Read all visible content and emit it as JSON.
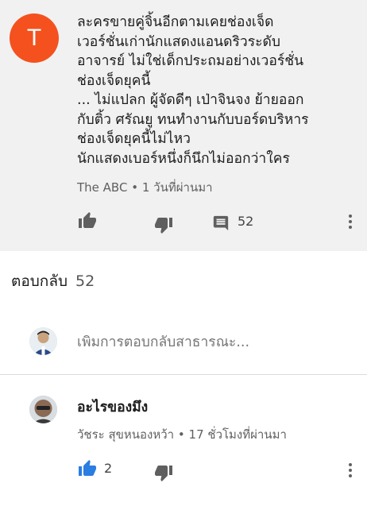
{
  "comment": {
    "avatar_letter": "T",
    "avatar_color": "#f4511e",
    "text": "ละครขายคู่จิ้นอีกตามเคยช่องเจ็ด\nเวอร์ชั่นเก่านักแสดงแอนดริวระดับ\nอาจารย์ ไม่ใช่เด็กประถมอย่างเวอร์ชั่น\nช่องเจ็ดยุคนี้\n... ไม่แปลก ผู้จัดดีๆ เป่าจินจง ย้ายออก\nกับติ้ว ศรัณยู ทนทำงานกับบอร์ดบริหาร\nช่องเจ็ดยุคนี้ไม่ไหว\nนักแสดงเบอร์หนึ่งก็นึกไม่ออกว่าใคร",
    "author": "The ABC",
    "separator": "•",
    "time": "1 วันที่ผ่านมา",
    "reply_count": "52",
    "icons": [
      "thumb-up-icon",
      "thumb-down-icon",
      "comment-icon",
      "more-vert-icon"
    ]
  },
  "replies_section": {
    "label": "ตอบกลับ",
    "count": "52",
    "input_placeholder": "เพิ่มการตอบกลับสาธารณะ..."
  },
  "reply": {
    "title": "อะไรของมึง",
    "author": "วัชระ สุขหนองหว้า",
    "separator": "•",
    "time": "17 ชั่วโมงที่ผ่านมา",
    "like_count": "2",
    "like_color": "#2a7de1",
    "icons": [
      "thumb-up-icon",
      "thumb-down-icon",
      "more-vert-icon"
    ]
  }
}
